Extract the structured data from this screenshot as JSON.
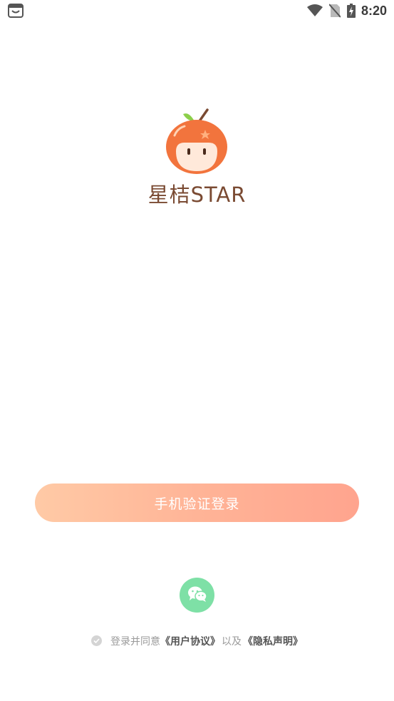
{
  "status_bar": {
    "time": "8:20",
    "icons": [
      "notification-bag-icon",
      "wifi-icon",
      "no-sim-icon",
      "battery-charging-icon"
    ]
  },
  "brand": {
    "name": "星桔STAR",
    "logo_icon": "tangerine-mascot-logo"
  },
  "login": {
    "phone_button_label": "手机验证登录"
  },
  "social": {
    "wechat_icon": "wechat-icon"
  },
  "agreement": {
    "prefix": "登录并同意",
    "user_agreement": "《用户协议》",
    "joiner": "以及",
    "privacy": "《隐私声明》"
  },
  "colors": {
    "button_gradient_start": "#ffcaa6",
    "button_gradient_end": "#ffa48e",
    "wechat_green": "#7ee0a6",
    "brand_text": "#7a4a32",
    "logo_orange": "#f2743d"
  }
}
